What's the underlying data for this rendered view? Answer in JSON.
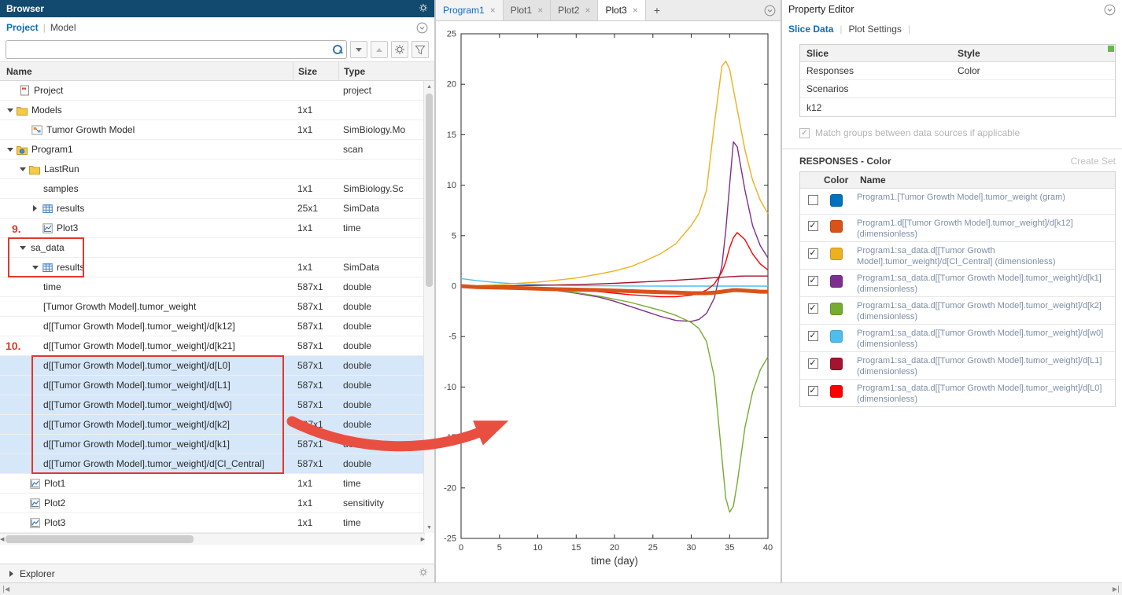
{
  "colors": {
    "accent_blue": "#0B6BC2",
    "panel_header": "#12496E",
    "selection": "#D5E7F9",
    "annotation_red": "#E1382C",
    "arrow_red": "#E94F41",
    "green_indicator": "#62BB46"
  },
  "glyphs": {
    "close": "×",
    "add": "+",
    "scroll_up": "▲",
    "scroll_down": "▼",
    "scroll_left": "◀",
    "scroll_right": "▶",
    "check": "✓",
    "separator": "|"
  },
  "browser": {
    "title": "Browser",
    "nav": {
      "project": "Project",
      "model": "Model"
    },
    "search_value": "",
    "columns": [
      "Name",
      "Size",
      "Type"
    ],
    "rows": [
      {
        "name": "Project",
        "size": "",
        "type": "project",
        "level": 1,
        "caret": null,
        "icon": "project",
        "spacer": false
      },
      {
        "name": "Models",
        "size": "1x1",
        "type": "",
        "level": 0,
        "caret": "open",
        "icon": "folder"
      },
      {
        "name": "Tumor Growth Model",
        "size": "1x1",
        "type": "SimBiology.Mo",
        "level": 2,
        "caret": null,
        "icon": "model",
        "spacer": false
      },
      {
        "name": "Program1",
        "size": "",
        "type": "scan",
        "level": 0,
        "caret": "open",
        "icon": "program"
      },
      {
        "name": "LastRun",
        "size": "",
        "type": "",
        "level": 1,
        "caret": "open",
        "icon": "folder"
      },
      {
        "name": "samples",
        "size": "1x1",
        "type": "SimBiology.Sc",
        "level": 2,
        "caret": null,
        "icon": null
      },
      {
        "name": "results",
        "size": "25x1",
        "type": "SimData",
        "level": 2,
        "caret": "closed",
        "icon": "table"
      },
      {
        "name": "Plot3",
        "size": "1x1",
        "type": "time",
        "level": 2,
        "caret": null,
        "icon": "plot"
      },
      {
        "name": "sa_data",
        "size": "",
        "type": "",
        "level": 1,
        "caret": "open",
        "icon": null
      },
      {
        "name": "results",
        "size": "1x1",
        "type": "SimData",
        "level": 2,
        "caret": "open",
        "icon": "table"
      },
      {
        "name": "time",
        "size": "587x1",
        "type": "double",
        "level": 2,
        "caret": null,
        "icon": null
      },
      {
        "name": "[Tumor Growth Model].tumor_weight",
        "size": "587x1",
        "type": "double",
        "level": 2,
        "caret": null,
        "icon": null
      },
      {
        "name": "d[[Tumor Growth Model].tumor_weight]/d[k12]",
        "size": "587x1",
        "type": "double",
        "level": 2,
        "caret": null,
        "icon": null
      },
      {
        "name": "d[[Tumor Growth Model].tumor_weight]/d[k21]",
        "size": "587x1",
        "type": "double",
        "level": 2,
        "caret": null,
        "icon": null
      },
      {
        "name": "d[[Tumor Growth Model].tumor_weight]/d[L0]",
        "size": "587x1",
        "type": "double",
        "level": 2,
        "caret": null,
        "icon": null,
        "selected": true
      },
      {
        "name": "d[[Tumor Growth Model].tumor_weight]/d[L1]",
        "size": "587x1",
        "type": "double",
        "level": 2,
        "caret": null,
        "icon": null,
        "selected": true
      },
      {
        "name": "d[[Tumor Growth Model].tumor_weight]/d[w0]",
        "size": "587x1",
        "type": "double",
        "level": 2,
        "caret": null,
        "icon": null,
        "selected": true
      },
      {
        "name": "d[[Tumor Growth Model].tumor_weight]/d[k2]",
        "size": "587x1",
        "type": "double",
        "level": 2,
        "caret": null,
        "icon": null,
        "selected": true
      },
      {
        "name": "d[[Tumor Growth Model].tumor_weight]/d[k1]",
        "size": "587x1",
        "type": "double",
        "level": 2,
        "caret": null,
        "icon": null,
        "selected": true
      },
      {
        "name": "d[[Tumor Growth Model].tumor_weight]/d[Cl_Central]",
        "size": "587x1",
        "type": "double",
        "level": 2,
        "caret": null,
        "icon": null,
        "selected": true
      },
      {
        "name": "Plot1",
        "size": "1x1",
        "type": "time",
        "level": 1,
        "caret": null,
        "icon": "plot"
      },
      {
        "name": "Plot2",
        "size": "1x1",
        "type": "sensitivity",
        "level": 1,
        "caret": null,
        "icon": "plot"
      },
      {
        "name": "Plot3",
        "size": "1x1",
        "type": "time",
        "level": 1,
        "caret": null,
        "icon": "plot"
      }
    ],
    "explorer": "Explorer"
  },
  "plot_tabs": {
    "tabs": [
      {
        "label": "Program1",
        "kind": "program",
        "active": false
      },
      {
        "label": "Plot1",
        "kind": "plot",
        "active": false
      },
      {
        "label": "Plot2",
        "kind": "plot",
        "active": false
      },
      {
        "label": "Plot3",
        "kind": "plot",
        "active": true
      }
    ]
  },
  "chart_data": {
    "type": "line",
    "title": "",
    "xlabel": "time (day)",
    "ylabel": "",
    "xlim": [
      0,
      40
    ],
    "ylim": [
      -25,
      25
    ],
    "xticks": [
      0,
      5,
      10,
      15,
      20,
      25,
      30,
      35,
      40
    ],
    "yticks": [
      -25,
      -20,
      -15,
      -10,
      -5,
      0,
      5,
      10,
      15,
      20,
      25
    ],
    "grid": false,
    "legend": false,
    "x": [
      0,
      2,
      5,
      8,
      10,
      12,
      15,
      18,
      20,
      22,
      24,
      26,
      28,
      30,
      31,
      32,
      33,
      34,
      34.5,
      35,
      35.5,
      36,
      37,
      38,
      39,
      40
    ],
    "series": [
      {
        "name": "d[[Tumor Growth Model].tumor_weight]/d[w0]",
        "color": "#4DBEEE",
        "width": 1.4,
        "values": [
          0.75,
          0.55,
          0.33,
          0.2,
          0.14,
          0.1,
          0.05,
          0.03,
          0.02,
          0.01,
          0.01,
          0,
          0,
          0,
          0,
          0,
          0,
          0,
          0,
          0,
          0,
          0,
          0,
          0,
          0,
          0
        ]
      },
      {
        "name": "d[[Tumor Growth Model].tumor_weight]/d[L1]",
        "color": "#A2142F",
        "width": 1.4,
        "values": [
          0,
          0,
          0.02,
          0.05,
          0.08,
          0.1,
          0.15,
          0.22,
          0.28,
          0.35,
          0.42,
          0.5,
          0.58,
          0.68,
          0.72,
          0.78,
          0.83,
          0.88,
          0.9,
          0.93,
          0.95,
          0.97,
          1,
          1,
          1,
          1
        ]
      },
      {
        "name": "d[[Tumor Growth Model].tumor_weight]/d[Cl_Central]",
        "color": "#EDB120",
        "width": 1.4,
        "values": [
          0,
          0.05,
          0.15,
          0.3,
          0.4,
          0.55,
          0.8,
          1.2,
          1.5,
          1.9,
          2.5,
          3.2,
          4.2,
          6,
          7.2,
          9.5,
          16,
          21.8,
          22.3,
          21.5,
          19.5,
          17.5,
          13.5,
          10.5,
          8.5,
          7.2
        ]
      },
      {
        "name": "d[[Tumor Growth Model].tumor_weight]/d[k1]",
        "color": "#7E2F8E",
        "width": 1.4,
        "values": [
          0,
          0,
          -0.05,
          -0.15,
          -0.25,
          -0.4,
          -0.7,
          -1.1,
          -1.5,
          -2,
          -2.5,
          -3,
          -3.4,
          -3.5,
          -3.3,
          -2.7,
          -1.2,
          2,
          5.5,
          10,
          14.3,
          13.8,
          9.5,
          6,
          4,
          2.8
        ]
      },
      {
        "name": "d[[Tumor Growth Model].tumor_weight]/d[k2]",
        "color": "#77AC30",
        "width": 1.4,
        "values": [
          0,
          0,
          -0.08,
          -0.18,
          -0.28,
          -0.4,
          -0.65,
          -1,
          -1.3,
          -1.6,
          -2,
          -2.4,
          -2.9,
          -3.6,
          -4.2,
          -5.5,
          -9,
          -17,
          -21,
          -22.4,
          -21.8,
          -19.5,
          -14,
          -10.5,
          -8.3,
          -7
        ]
      },
      {
        "name": "d[[Tumor Growth Model].tumor_weight]/d[L0]",
        "color": "#FF0000",
        "width": 1.4,
        "values": [
          0,
          -0.02,
          -0.06,
          -0.12,
          -0.18,
          -0.25,
          -0.38,
          -0.55,
          -0.7,
          -0.85,
          -0.95,
          -1.05,
          -1.05,
          -0.9,
          -0.7,
          -0.4,
          0.2,
          1.4,
          2.4,
          3.8,
          4.8,
          5.3,
          4.6,
          3.2,
          2.2,
          1.6
        ]
      },
      {
        "name": "d[[Tumor Growth Model].tumor_weight]/d[k12]",
        "color": "#D95319",
        "width": 5,
        "values": [
          0,
          -0.1,
          -0.15,
          -0.2,
          -0.25,
          -0.3,
          -0.35,
          -0.4,
          -0.45,
          -0.5,
          -0.55,
          -0.6,
          -0.65,
          -0.7,
          -0.7,
          -0.7,
          -0.65,
          -0.55,
          -0.5,
          -0.45,
          -0.4,
          -0.4,
          -0.45,
          -0.5,
          -0.55,
          -0.55
        ]
      }
    ]
  },
  "property_editor": {
    "title": "Property Editor",
    "tabs": [
      "Slice Data",
      "Plot Settings"
    ],
    "active_tab": "Slice Data",
    "slice_table": {
      "headers": [
        "Slice",
        "Style"
      ],
      "rows": [
        {
          "slice": "Responses",
          "style": "Color"
        },
        {
          "slice": "Scenarios",
          "style": ""
        },
        {
          "slice": "k12",
          "style": ""
        }
      ]
    },
    "match_groups": {
      "label": "Match groups between data sources if applicable",
      "checked": true,
      "enabled": false
    },
    "responses_section": {
      "title": "RESPONSES - Color",
      "action": "Create Set",
      "headers": [
        "Color",
        "Name"
      ],
      "rows": [
        {
          "checked": false,
          "color": "#0072BD",
          "name": "Program1.[Tumor Growth Model].tumor_weight (gram)"
        },
        {
          "checked": true,
          "color": "#D95319",
          "name": "Program1.d[[Tumor Growth Model].tumor_weight]/d[k12] (dimensionless)"
        },
        {
          "checked": true,
          "color": "#EDB120",
          "name": "Program1:sa_data.d[[Tumor Growth Model].tumor_weight]/d[Cl_Central] (dimensionless)"
        },
        {
          "checked": true,
          "color": "#7E2F8E",
          "name": "Program1:sa_data.d[[Tumor Growth Model].tumor_weight]/d[k1] (dimensionless)"
        },
        {
          "checked": true,
          "color": "#77AC30",
          "name": "Program1:sa_data.d[[Tumor Growth Model].tumor_weight]/d[k2] (dimensionless)"
        },
        {
          "checked": true,
          "color": "#4DBEEE",
          "name": "Program1:sa_data.d[[Tumor Growth Model].tumor_weight]/d[w0] (dimensionless)"
        },
        {
          "checked": true,
          "color": "#A2142F",
          "name": "Program1:sa_data.d[[Tumor Growth Model].tumor_weight]/d[L1] (dimensionless)"
        },
        {
          "checked": true,
          "color": "#FF0000",
          "name": "Program1:sa_data.d[[Tumor Growth Model].tumor_weight]/d[L0] (dimensionless)"
        }
      ]
    }
  },
  "annotations": {
    "step9": "9.",
    "step10": "10."
  }
}
